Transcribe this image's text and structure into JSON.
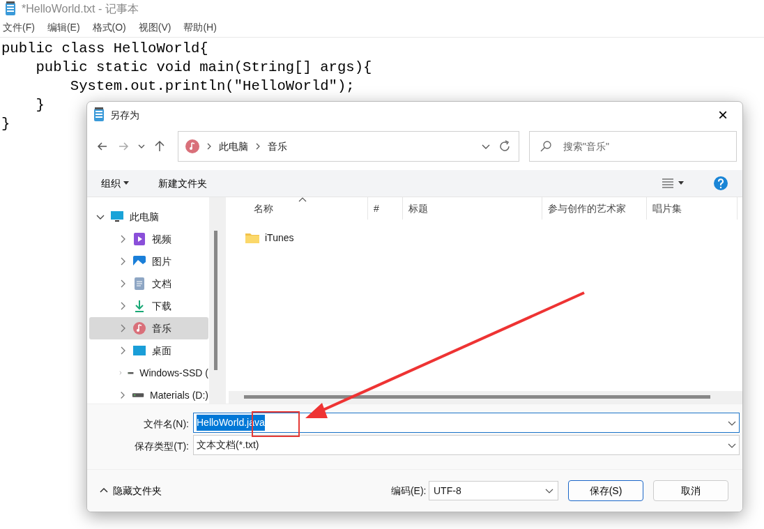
{
  "window": {
    "title": "*HelloWorld.txt - 记事本"
  },
  "menu": [
    "文件(F)",
    "编辑(E)",
    "格式(O)",
    "视图(V)",
    "帮助(H)"
  ],
  "editor": {
    "lines": [
      "public class HelloWorld{",
      "    public static void main(String[] args){",
      "        System.out.println(\"HelloWorld\");",
      "    }",
      "}"
    ]
  },
  "dialog": {
    "title": "另存为",
    "close": "×",
    "breadcrumb": [
      "此电脑",
      "音乐"
    ],
    "search": {
      "placeholder": "搜索\"音乐\""
    },
    "toolbar": {
      "organize": "组织",
      "new_folder": "新建文件夹"
    },
    "tree": [
      {
        "label": "此电脑",
        "kind": "computer",
        "expanded": true,
        "selected": false,
        "children": [
          {
            "label": "视频",
            "kind": "video",
            "expanded": false,
            "selected": false
          },
          {
            "label": "图片",
            "kind": "picture",
            "expanded": false,
            "selected": false
          },
          {
            "label": "文档",
            "kind": "document",
            "expanded": false,
            "selected": false
          },
          {
            "label": "下载",
            "kind": "download",
            "expanded": false,
            "selected": false
          },
          {
            "label": "音乐",
            "kind": "music",
            "expanded": false,
            "selected": true
          },
          {
            "label": "桌面",
            "kind": "desktop",
            "expanded": false,
            "selected": false
          },
          {
            "label": "Windows-SSD (",
            "kind": "drive",
            "expanded": false,
            "selected": false
          },
          {
            "label": "Materials (D:)",
            "kind": "drive",
            "expanded": false,
            "selected": false
          }
        ]
      }
    ],
    "columns": [
      {
        "label": "名称",
        "sorted": true
      },
      {
        "label": "#",
        "sorted": false
      },
      {
        "label": "标题",
        "sorted": false
      },
      {
        "label": "参与创作的艺术家",
        "sorted": false
      },
      {
        "label": "唱片集",
        "sorted": false
      }
    ],
    "files": [
      {
        "name": "iTunes",
        "kind": "folder"
      }
    ],
    "filename": {
      "label": "文件名(N):",
      "value": "HelloWorld.java",
      "text_selected": true
    },
    "filetype": {
      "label": "保存类型(T):",
      "value": "文本文档(*.txt)"
    },
    "hide_folders": "隐藏文件夹",
    "encoding": {
      "label": "编码(E):",
      "value": "UTF-8"
    },
    "buttons": [
      {
        "label": "保存(S)",
        "default": true
      },
      {
        "label": "取消",
        "default": false
      }
    ]
  }
}
